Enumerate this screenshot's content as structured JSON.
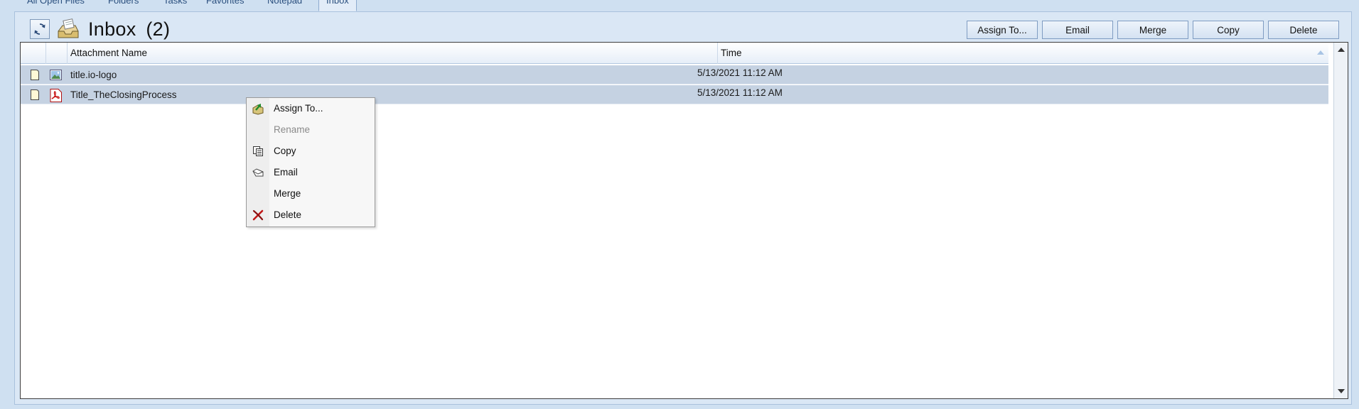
{
  "tabs": [
    {
      "label": "All Open Files"
    },
    {
      "label": "Folders"
    },
    {
      "label": "Tasks"
    },
    {
      "label": "Favorites"
    },
    {
      "label": "Notepad"
    },
    {
      "label": "Inbox",
      "active": true
    }
  ],
  "header": {
    "title": "Inbox",
    "count": "(2)",
    "refresh_icon": "refresh-icon",
    "inbox_icon": "inbox-tray-icon"
  },
  "toolbar": {
    "assign_label": "Assign To...",
    "email_label": "Email",
    "merge_label": "Merge",
    "copy_label": "Copy",
    "delete_label": "Delete"
  },
  "grid": {
    "columns": {
      "name": "Attachment Name",
      "time": "Time"
    },
    "rows": [
      {
        "name": "title.io-logo",
        "time": "5/13/2021 11:12 AM",
        "icon": "image-file-icon"
      },
      {
        "name": "Title_TheClosingProcess",
        "time": "5/13/2021 11:12 AM",
        "icon": "pdf-file-icon"
      }
    ]
  },
  "context_menu": {
    "items": [
      {
        "label": "Assign To...",
        "icon": "assign-icon",
        "enabled": true
      },
      {
        "label": "Rename",
        "icon": "",
        "enabled": false
      },
      {
        "label": "Copy",
        "icon": "copy-icon",
        "enabled": true
      },
      {
        "label": "Email",
        "icon": "email-icon",
        "enabled": true
      },
      {
        "label": "Merge",
        "icon": "",
        "enabled": true
      },
      {
        "label": "Delete",
        "icon": "delete-icon",
        "enabled": true
      }
    ]
  },
  "colors": {
    "background": "#cfe0f1",
    "selected_row": "#c5d2e2",
    "accent": "#2a4f7e"
  }
}
